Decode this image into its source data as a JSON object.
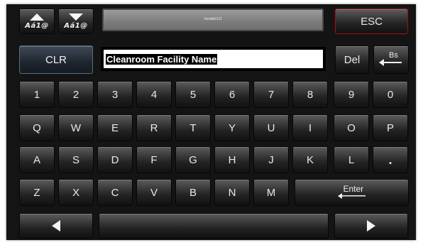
{
  "header": {
    "case_up_label": "Aá1@",
    "case_down_label": "Aá1@",
    "variable_name": "Variable111",
    "esc_label": "ESC"
  },
  "editor": {
    "clr_label": "CLR",
    "value": "Cleanroom Facility Name",
    "del_label": "Del",
    "bs_label": "Bs"
  },
  "rows": {
    "digits": [
      "1",
      "2",
      "3",
      "4",
      "5",
      "6",
      "7",
      "8",
      "9",
      "0"
    ],
    "row_q": [
      "Q",
      "W",
      "E",
      "R",
      "T",
      "Y",
      "U",
      "I",
      "O",
      "P"
    ],
    "row_a": [
      "A",
      "S",
      "D",
      "F",
      "G",
      "H",
      "J",
      "K",
      "L",
      "."
    ],
    "row_z": [
      "Z",
      "X",
      "C",
      "V",
      "B",
      "N",
      "M"
    ],
    "enter_label": "Enter"
  },
  "colors": {
    "esc_border": "#8a1818",
    "clr_border": "#5a6c80"
  },
  "icons": [
    "arrow-up-icon",
    "arrow-down-icon",
    "enter-arrow-icon",
    "backspace-arrow-icon",
    "arrow-left-icon",
    "arrow-right-icon"
  ]
}
